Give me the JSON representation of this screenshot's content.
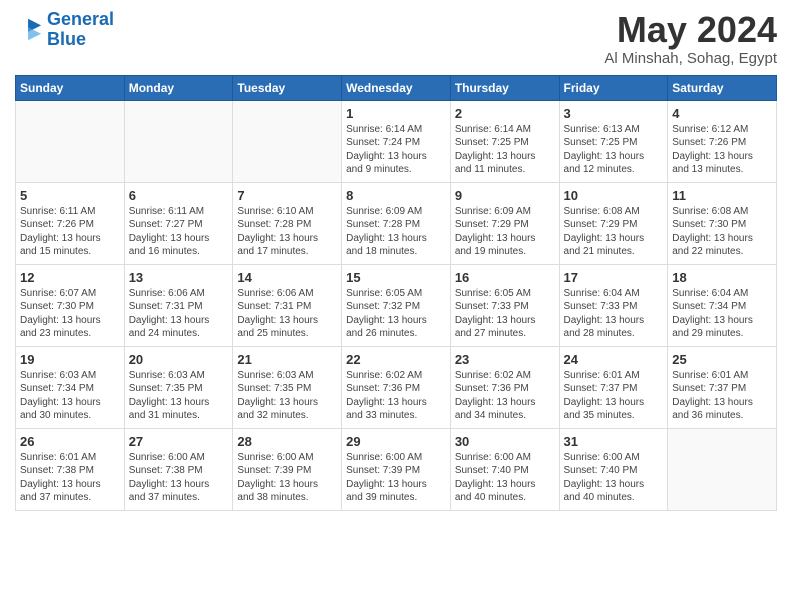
{
  "logo": {
    "line1": "General",
    "line2": "Blue"
  },
  "title": {
    "month": "May 2024",
    "location": "Al Minshah, Sohag, Egypt"
  },
  "weekdays": [
    "Sunday",
    "Monday",
    "Tuesday",
    "Wednesday",
    "Thursday",
    "Friday",
    "Saturday"
  ],
  "weeks": [
    [
      {
        "day": "",
        "info": ""
      },
      {
        "day": "",
        "info": ""
      },
      {
        "day": "",
        "info": ""
      },
      {
        "day": "1",
        "info": "Sunrise: 6:14 AM\nSunset: 7:24 PM\nDaylight: 13 hours\nand 9 minutes."
      },
      {
        "day": "2",
        "info": "Sunrise: 6:14 AM\nSunset: 7:25 PM\nDaylight: 13 hours\nand 11 minutes."
      },
      {
        "day": "3",
        "info": "Sunrise: 6:13 AM\nSunset: 7:25 PM\nDaylight: 13 hours\nand 12 minutes."
      },
      {
        "day": "4",
        "info": "Sunrise: 6:12 AM\nSunset: 7:26 PM\nDaylight: 13 hours\nand 13 minutes."
      }
    ],
    [
      {
        "day": "5",
        "info": "Sunrise: 6:11 AM\nSunset: 7:26 PM\nDaylight: 13 hours\nand 15 minutes."
      },
      {
        "day": "6",
        "info": "Sunrise: 6:11 AM\nSunset: 7:27 PM\nDaylight: 13 hours\nand 16 minutes."
      },
      {
        "day": "7",
        "info": "Sunrise: 6:10 AM\nSunset: 7:28 PM\nDaylight: 13 hours\nand 17 minutes."
      },
      {
        "day": "8",
        "info": "Sunrise: 6:09 AM\nSunset: 7:28 PM\nDaylight: 13 hours\nand 18 minutes."
      },
      {
        "day": "9",
        "info": "Sunrise: 6:09 AM\nSunset: 7:29 PM\nDaylight: 13 hours\nand 19 minutes."
      },
      {
        "day": "10",
        "info": "Sunrise: 6:08 AM\nSunset: 7:29 PM\nDaylight: 13 hours\nand 21 minutes."
      },
      {
        "day": "11",
        "info": "Sunrise: 6:08 AM\nSunset: 7:30 PM\nDaylight: 13 hours\nand 22 minutes."
      }
    ],
    [
      {
        "day": "12",
        "info": "Sunrise: 6:07 AM\nSunset: 7:30 PM\nDaylight: 13 hours\nand 23 minutes."
      },
      {
        "day": "13",
        "info": "Sunrise: 6:06 AM\nSunset: 7:31 PM\nDaylight: 13 hours\nand 24 minutes."
      },
      {
        "day": "14",
        "info": "Sunrise: 6:06 AM\nSunset: 7:31 PM\nDaylight: 13 hours\nand 25 minutes."
      },
      {
        "day": "15",
        "info": "Sunrise: 6:05 AM\nSunset: 7:32 PM\nDaylight: 13 hours\nand 26 minutes."
      },
      {
        "day": "16",
        "info": "Sunrise: 6:05 AM\nSunset: 7:33 PM\nDaylight: 13 hours\nand 27 minutes."
      },
      {
        "day": "17",
        "info": "Sunrise: 6:04 AM\nSunset: 7:33 PM\nDaylight: 13 hours\nand 28 minutes."
      },
      {
        "day": "18",
        "info": "Sunrise: 6:04 AM\nSunset: 7:34 PM\nDaylight: 13 hours\nand 29 minutes."
      }
    ],
    [
      {
        "day": "19",
        "info": "Sunrise: 6:03 AM\nSunset: 7:34 PM\nDaylight: 13 hours\nand 30 minutes."
      },
      {
        "day": "20",
        "info": "Sunrise: 6:03 AM\nSunset: 7:35 PM\nDaylight: 13 hours\nand 31 minutes."
      },
      {
        "day": "21",
        "info": "Sunrise: 6:03 AM\nSunset: 7:35 PM\nDaylight: 13 hours\nand 32 minutes."
      },
      {
        "day": "22",
        "info": "Sunrise: 6:02 AM\nSunset: 7:36 PM\nDaylight: 13 hours\nand 33 minutes."
      },
      {
        "day": "23",
        "info": "Sunrise: 6:02 AM\nSunset: 7:36 PM\nDaylight: 13 hours\nand 34 minutes."
      },
      {
        "day": "24",
        "info": "Sunrise: 6:01 AM\nSunset: 7:37 PM\nDaylight: 13 hours\nand 35 minutes."
      },
      {
        "day": "25",
        "info": "Sunrise: 6:01 AM\nSunset: 7:37 PM\nDaylight: 13 hours\nand 36 minutes."
      }
    ],
    [
      {
        "day": "26",
        "info": "Sunrise: 6:01 AM\nSunset: 7:38 PM\nDaylight: 13 hours\nand 37 minutes."
      },
      {
        "day": "27",
        "info": "Sunrise: 6:00 AM\nSunset: 7:38 PM\nDaylight: 13 hours\nand 37 minutes."
      },
      {
        "day": "28",
        "info": "Sunrise: 6:00 AM\nSunset: 7:39 PM\nDaylight: 13 hours\nand 38 minutes."
      },
      {
        "day": "29",
        "info": "Sunrise: 6:00 AM\nSunset: 7:39 PM\nDaylight: 13 hours\nand 39 minutes."
      },
      {
        "day": "30",
        "info": "Sunrise: 6:00 AM\nSunset: 7:40 PM\nDaylight: 13 hours\nand 40 minutes."
      },
      {
        "day": "31",
        "info": "Sunrise: 6:00 AM\nSunset: 7:40 PM\nDaylight: 13 hours\nand 40 minutes."
      },
      {
        "day": "",
        "info": ""
      }
    ]
  ]
}
